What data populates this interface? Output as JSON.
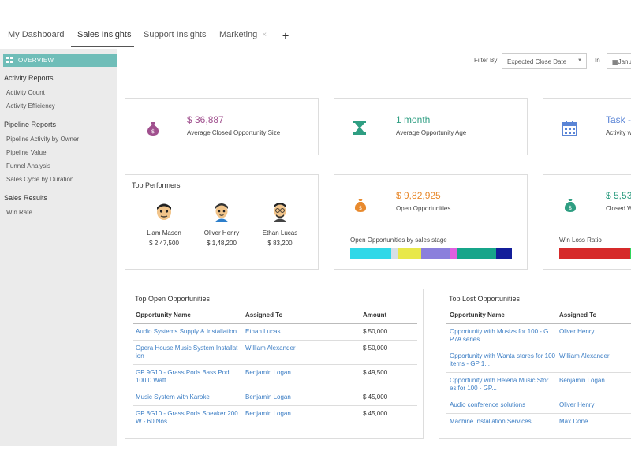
{
  "tabs": [
    {
      "label": "My Dashboard"
    },
    {
      "label": "Sales Insights"
    },
    {
      "label": "Support Insights"
    },
    {
      "label": "Marketing",
      "close": "×"
    }
  ],
  "tab_add": "+",
  "sidebar": {
    "overview": "OVERVIEW",
    "sections": [
      {
        "title": "Activity Reports",
        "items": [
          "Activity Count",
          "Activity Efficiency"
        ]
      },
      {
        "title": "Pipeline Reports",
        "items": [
          "Pipeline Activity by Owner",
          "Pipeline Value",
          "Funnel Analysis",
          "Sales Cycle by Duration"
        ]
      },
      {
        "title": "Sales Results",
        "items": [
          "Win Rate"
        ]
      }
    ]
  },
  "filter": {
    "label": "Filter By",
    "value": "Expected Close Date",
    "in_label": "In",
    "date_value": "Janu"
  },
  "kpis": [
    {
      "value": "$ 36,887",
      "label": "Average Closed Opportunity Size",
      "color": "#a0508e",
      "icon": "money-bag-icon"
    },
    {
      "value": "1 month",
      "label": "Average Opportunity Age",
      "color": "#2f9e82",
      "icon": "hourglass-icon"
    },
    {
      "value": "Task -",
      "label": "Activity w",
      "color": "#5b85d6",
      "icon": "calendar-icon"
    }
  ],
  "top_performers": {
    "title": "Top Performers",
    "people": [
      {
        "name": "Liam Mason",
        "amount": "$ 2,47,500"
      },
      {
        "name": "Oliver Henry",
        "amount": "$ 1,48,200"
      },
      {
        "name": "Ethan Lucas",
        "amount": "$ 83,200"
      }
    ]
  },
  "open_opps": {
    "value": "$ 9,82,925",
    "label": "Open Opportunities",
    "color": "#e88a2e",
    "icon": "money-bag-icon",
    "chart_label": "Open Opportunities by sales stage",
    "segments": [
      {
        "share": 0.256,
        "color": "#2fd8e8"
      },
      {
        "share": 0.044,
        "color": "#d6dfe6"
      },
      {
        "share": 0.137,
        "color": "#e8e84a"
      },
      {
        "share": 0.181,
        "color": "#8a7fdc"
      },
      {
        "share": 0.044,
        "color": "#e060e0"
      },
      {
        "share": 0.24,
        "color": "#17a58a"
      },
      {
        "share": 0.098,
        "color": "#131e9a"
      }
    ]
  },
  "closed_won": {
    "value": "$ 5,53",
    "label": "Closed W",
    "color": "#2f9e82",
    "icon": "money-bag-icon",
    "chart_label": "Win Loss Ratio",
    "segments": [
      {
        "share": 0.62,
        "color": "#d62a2a"
      },
      {
        "share": 0.38,
        "color": "#2ed65a"
      }
    ]
  },
  "top_open": {
    "title": "Top Open Opportunities",
    "columns": [
      "Opportunity Name",
      "Assigned To",
      "Amount"
    ],
    "rows": [
      {
        "name": "Audio Systems Supply & Installation",
        "assigned": "Ethan Lucas",
        "amount": "$ 50,000"
      },
      {
        "name": "Opera House Music System Installat ion",
        "assigned": "William Alexander",
        "amount": "$ 50,000"
      },
      {
        "name": "GP 9G10 - Grass Pods Bass Pod 100 0 Watt",
        "assigned": "Benjamin Logan",
        "amount": "$ 49,500"
      },
      {
        "name": "Music System with Karoke",
        "assigned": "Benjamin Logan",
        "amount": "$ 45,000"
      },
      {
        "name": "GP 8G10 - Grass Pods Speaker 200 W - 60 Nos.",
        "assigned": "Benjamin Logan",
        "amount": "$ 45,000"
      }
    ]
  },
  "top_lost": {
    "title": "Top Lost Opportunities",
    "columns": [
      "Opportunity Name",
      "Assigned To"
    ],
    "rows": [
      {
        "name": "Opportunity with Musizs for 100 - G P7A series",
        "assigned": "Oliver Henry"
      },
      {
        "name": "Opportunity with Wanta stores for 100 items - GP 1...",
        "assigned": "William Alexander"
      },
      {
        "name": "Opportunity with Helena Music Stor es for 100 - GP...",
        "assigned": "Benjamin Logan"
      },
      {
        "name": "Audio conference solutions",
        "assigned": "Oliver Henry"
      },
      {
        "name": "Machine Installation Services",
        "assigned": "Max Done"
      }
    ]
  }
}
